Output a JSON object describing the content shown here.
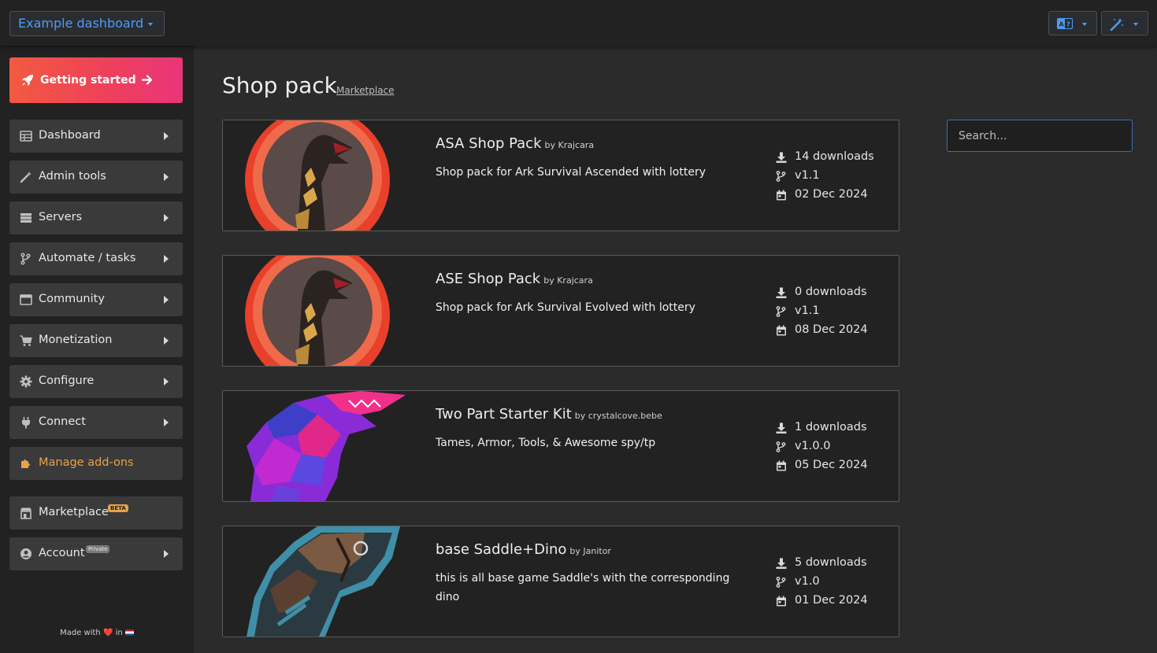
{
  "topbar": {
    "dashboard_label": "Example dashboard"
  },
  "sidebar": {
    "getting_started": "Getting started",
    "items": [
      {
        "label": "Dashboard",
        "icon": "table-icon"
      },
      {
        "label": "Admin tools",
        "icon": "magic-wand-icon"
      },
      {
        "label": "Servers",
        "icon": "server-icon"
      },
      {
        "label": "Automate / tasks",
        "icon": "branch-icon"
      },
      {
        "label": "Community",
        "icon": "window-icon"
      },
      {
        "label": "Monetization",
        "icon": "cart-icon"
      },
      {
        "label": "Configure",
        "icon": "gear-icon"
      },
      {
        "label": "Connect",
        "icon": "plug-icon"
      },
      {
        "label": "Manage add-ons",
        "icon": "puzzle-icon"
      },
      {
        "label": "Marketplace",
        "icon": "store-icon",
        "badge": "BETA"
      },
      {
        "label": "Account",
        "icon": "user-circle-icon",
        "badge": "Private"
      }
    ],
    "footer": {
      "made_with": "Made with",
      "in": "in"
    }
  },
  "main": {
    "title": "Shop pack",
    "subtitle": "Marketplace",
    "search_placeholder": "Search...",
    "cards": [
      {
        "title": "ASA Shop Pack",
        "by": "by Krajcara",
        "description": "Shop pack for Ark Survival Ascended with lottery",
        "downloads": "14 downloads",
        "version": "v1.1",
        "date": "02 Dec 2024"
      },
      {
        "title": "ASE Shop Pack",
        "by": "by Krajcara",
        "description": "Shop pack for Ark Survival Evolved with lottery",
        "downloads": "0 downloads",
        "version": "v1.1",
        "date": "08 Dec 2024"
      },
      {
        "title": "Two Part Starter Kit",
        "by": "by crystalcove.bebe",
        "description": "Tames, Armor, Tools, & Awesome spy/tp",
        "downloads": "1 downloads",
        "version": "v1.0.0",
        "date": "05 Dec 2024"
      },
      {
        "title": "base Saddle+Dino",
        "by": "by Janitor",
        "description": "this is all base game Saddle's with the corresponding dino",
        "downloads": "5 downloads",
        "version": "v1.0",
        "date": "01 Dec 2024"
      }
    ]
  },
  "colors": {
    "accent_blue": "#4d9cf6",
    "gradient_start": "#f25a3f",
    "gradient_end": "#e8357a",
    "addon_orange": "#e8a24a"
  }
}
